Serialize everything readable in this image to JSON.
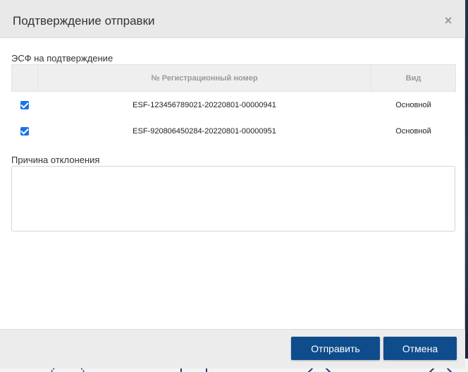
{
  "dialog": {
    "title": "Подтверждение отправки",
    "close_icon": "close-icon"
  },
  "esf_section": {
    "label": "ЭСФ на подтверждение",
    "columns": {
      "number": "№ Регистрационный номер",
      "kind": "Вид"
    },
    "rows": [
      {
        "checked": true,
        "number": "ESF-123456789021-20220801-00000941",
        "kind": "Основной"
      },
      {
        "checked": true,
        "number": "ESF-920806450284-20220801-00000951",
        "kind": "Основной"
      }
    ]
  },
  "reason": {
    "label": "Причина отклонения",
    "value": ""
  },
  "footer": {
    "send_label": "Отправить",
    "cancel_label": "Отмена"
  },
  "colors": {
    "primary_button": "#0f4c8c",
    "checkbox": "#1a73e8",
    "header_bg": "#e9e9e9"
  }
}
